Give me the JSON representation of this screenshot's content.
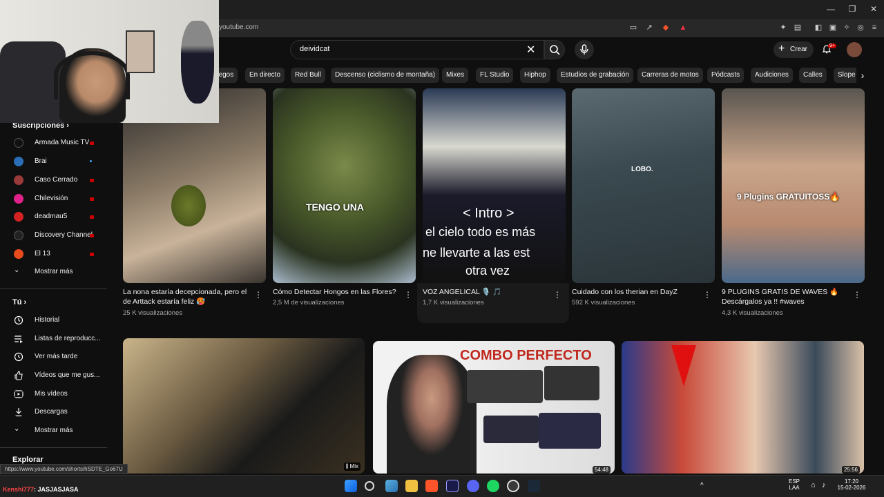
{
  "browser": {
    "url": "youtube.com",
    "status_url": "https://www.youtube.com/shorts/hSDTE_Go67U"
  },
  "header": {
    "search_value": "deividcat",
    "create_label": "Crear",
    "notif_badge": "9+"
  },
  "chips": [
    "Juegos",
    "En directo",
    "Red Bull",
    "Descenso (ciclismo de montaña)",
    "Mixes",
    "FL Studio",
    "Hiphop",
    "Estudios de grabación",
    "Carreras de motos",
    "Pódcasts",
    "Audiciones",
    "Calles",
    "Slope"
  ],
  "sidebar": {
    "subs_heading": "Suscripciones",
    "subscriptions": [
      {
        "label": "Armada Music TV",
        "icon": "armada-icon",
        "color": "#111111",
        "badge": "live"
      },
      {
        "label": "Brai",
        "icon": "brai-icon",
        "color": "#2a6fb5",
        "badge": "dot"
      },
      {
        "label": "Caso Cerrado",
        "icon": "caso-cerrado-icon",
        "color": "#9a3a3a",
        "badge": "live"
      },
      {
        "label": "Chilevisión",
        "icon": "chilevision-icon",
        "color": "#e0218a",
        "badge": "live"
      },
      {
        "label": "deadmau5",
        "icon": "deadmau5-icon",
        "color": "#d22222",
        "badge": "live"
      },
      {
        "label": "Discovery Channel",
        "icon": "discovery-icon",
        "color": "#222222",
        "badge": "live"
      },
      {
        "label": "El 13",
        "icon": "el13-icon",
        "color": "#e84b1c",
        "badge": "live"
      }
    ],
    "subs_more": "Mostrar más",
    "you_heading": "Tú",
    "you_items": [
      {
        "label": "Historial",
        "icon": "history-icon"
      },
      {
        "label": "Listas de reproducc...",
        "icon": "playlists-icon"
      },
      {
        "label": "Ver más tarde",
        "icon": "watch-later-icon"
      },
      {
        "label": "Vídeos que me gus...",
        "icon": "liked-icon"
      },
      {
        "label": "Mis vídeos",
        "icon": "my-videos-icon"
      },
      {
        "label": "Descargas",
        "icon": "downloads-icon"
      }
    ],
    "you_more": "Mostrar más",
    "explore_heading": "Explorar"
  },
  "shorts": [
    {
      "title": "La nona estaría decepcionada, pero el de Arttack estaría feliz 🥵",
      "meta": "25 K visualizaciones",
      "overlay": ""
    },
    {
      "title": "Cómo Detectar Hongos en las Flores?",
      "meta": "2,5 M de visualizaciones",
      "overlay": "TENGO UNA"
    },
    {
      "title": "VOZ ANGELICAL 🎙️ 🎵",
      "meta": "1,7 K visualizaciones",
      "overlay": "< Intro >",
      "lyrics": [
        "el cielo todo es más",
        "ne llevarte a las est",
        "otra vez"
      ]
    },
    {
      "title": "Cuidado con los therian en DayZ",
      "meta": "592 K visualizaciones",
      "overlay": "LOBO."
    },
    {
      "title": "9 PLUGINS GRATIS DE WAVES 🔥 Descárgalos ya !! #waves",
      "meta": "4,3 K visualizaciones",
      "overlay": "9 Plugins GRATUITOSS🔥"
    }
  ],
  "videos": [
    {
      "badge": "Mix",
      "overlay": ""
    },
    {
      "badge": "54:48",
      "overlay": "COMBO PERFECTO"
    },
    {
      "badge": "25:56",
      "overlay": ""
    }
  ],
  "chat": {
    "nick": "Kenshi777",
    "message": ": JASJASJASA"
  },
  "tray": {
    "lang": "ESP",
    "layout": "LAA",
    "time": "17:20",
    "date": "15-02-2026"
  }
}
